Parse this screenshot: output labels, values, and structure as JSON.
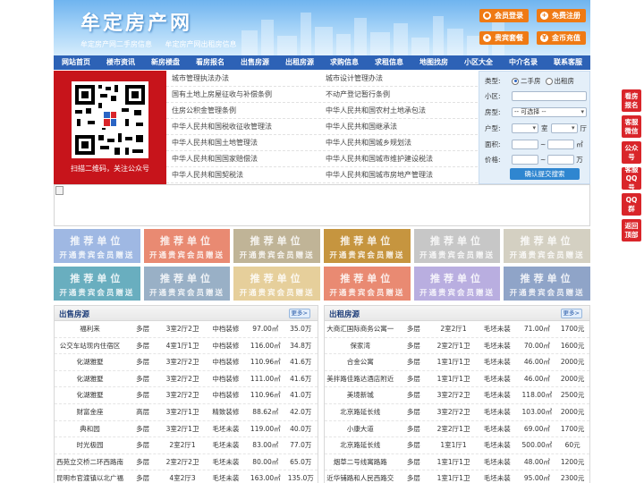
{
  "header": {
    "title": "牟定房产网",
    "subtitle_links": [
      "牟定房产网二手房信息",
      "牟定房产网出租房信息"
    ],
    "buttons": [
      {
        "label": "会员登录",
        "icon": "user-icon"
      },
      {
        "label": "免费注册",
        "icon": "register-icon"
      },
      {
        "label": "贵宾套餐",
        "icon": "vip-icon"
      },
      {
        "label": "金币充值",
        "icon": "coin-icon"
      }
    ]
  },
  "nav": [
    "网站首页",
    "楼市资讯",
    "新房楼盘",
    "看房报名",
    "出售房源",
    "出租房源",
    "求购信息",
    "求租信息",
    "地图找房",
    "小区大全",
    "中介名录",
    "联系客服"
  ],
  "qr": {
    "caption": "扫描二维码，关注公众号"
  },
  "policy_links": [
    [
      "城市管理执法办法",
      "城市设计管理办法"
    ],
    [
      "国有土地上房屋征收与补偿条例",
      "不动产登记暂行条例"
    ],
    [
      "住房公积金管理条例",
      "中华人民共和国农村土地承包法"
    ],
    [
      "中华人民共和国税收征收管理法",
      "中华人民共和国继承法"
    ],
    [
      "中华人民共和国土地管理法",
      "中华人民共和国城乡规划法"
    ],
    [
      "中华人民共和国国家赔偿法",
      "中华人民共和国城市维护建设税法"
    ],
    [
      "中华人民共和国契税法",
      "中华人民共和国城市房地产管理法"
    ]
  ],
  "search": {
    "type_label": "类型:",
    "type_options": [
      "二手房",
      "出租房"
    ],
    "community_label": "小区:",
    "house_type_label": "房型:",
    "house_type_value": "-- 可选择 --",
    "layout_label": "户型:",
    "room_unit": "室",
    "hall_unit": "厅",
    "area_label": "面积:",
    "area_unit": "㎡",
    "price_label": "价格:",
    "price_unit": "万",
    "range_sep": "~",
    "submit_label": "确认提交搜索"
  },
  "tiles": {
    "line1": "推荐单位",
    "line2": "开通贵宾会员赠送",
    "colors": [
      "#9fb8e3",
      "#e98a72",
      "#c0b497",
      "#c6953f",
      "#c7c7c7",
      "#d4d0c2",
      "#69aebf",
      "#99b0c6",
      "#e6cf9b",
      "#e98a72",
      "#b9aee0",
      "#8fa4c8"
    ]
  },
  "sale": {
    "title": "出售房源",
    "more": "更多>",
    "rows": [
      [
        "福利来",
        "多层",
        "3室2厅2卫",
        "中档装修",
        "97.00㎡",
        "35.0万"
      ],
      [
        "公交车站现内住宿区",
        "多层",
        "4室1厅1卫",
        "中档装修",
        "116.00㎡",
        "34.8万"
      ],
      [
        "化湖雅墅",
        "多层",
        "3室2厅2卫",
        "中档装修",
        "110.96㎡",
        "41.6万"
      ],
      [
        "化湖雅墅",
        "多层",
        "3室2厅2卫",
        "中档装修",
        "111.00㎡",
        "41.6万"
      ],
      [
        "化湖雅墅",
        "多层",
        "3室2厅2卫",
        "中档装修",
        "110.96㎡",
        "41.0万"
      ],
      [
        "财富金座",
        "高层",
        "3室2厅1卫",
        "精致装修",
        "88.62㎡",
        "42.0万"
      ],
      [
        "典和园",
        "多层",
        "3室2厅1卫",
        "毛坯未装",
        "119.00㎡",
        "40.0万"
      ],
      [
        "时光极园",
        "多层",
        "2室2厅1",
        "毛坯未装",
        "83.00㎡",
        "77.0万"
      ],
      [
        "西苑立交桥二环西路南",
        "多层",
        "2室2厅2卫",
        "毛坯未装",
        "80.00㎡",
        "65.0万"
      ],
      [
        "昆明市官渡镇以北广福",
        "多层",
        "4室2厅3",
        "毛坯未装",
        "163.00㎡",
        "135.0万"
      ]
    ]
  },
  "rent": {
    "title": "出租房源",
    "more": "更多>",
    "rows": [
      [
        "大商汇国际商务公寓一",
        "多层",
        "2室2厅1",
        "毛坯未装",
        "71.00㎡",
        "1700元"
      ],
      [
        "保家湾",
        "多层",
        "2室2厅1卫",
        "毛坯未装",
        "70.00㎡",
        "1600元"
      ],
      [
        "合金公寓",
        "多层",
        "1室1厅1卫",
        "毛坯未装",
        "46.00㎡",
        "2000元"
      ],
      [
        "美拌路佳路达酒店附近",
        "多层",
        "1室1厅1卫",
        "毛坯未装",
        "46.00㎡",
        "2000元"
      ],
      [
        "美境新城",
        "多层",
        "3室2厅2卫",
        "毛坯未装",
        "118.00㎡",
        "2500元"
      ],
      [
        "北京路延长线",
        "多层",
        "3室2厅2卫",
        "毛坯未装",
        "103.00㎡",
        "2000元"
      ],
      [
        "小康大道",
        "多层",
        "2室2厅1卫",
        "毛坯未装",
        "69.00㎡",
        "1700元"
      ],
      [
        "北京路延长线",
        "多层",
        "1室1厅1",
        "毛坯未装",
        "500.00㎡",
        "60元"
      ],
      [
        "烟草二号线寓路路",
        "多层",
        "1室1厅1卫",
        "毛坯未装",
        "48.00㎡",
        "1200元"
      ],
      [
        "近华铺路和人民西路交",
        "多层",
        "1室1厅1卫",
        "毛坯未装",
        "95.00㎡",
        "2300元"
      ]
    ]
  },
  "side_buttons": [
    "看房报名",
    "客服微信",
    "公众号",
    "客服QQ号",
    "QQ群",
    "返回顶部"
  ]
}
